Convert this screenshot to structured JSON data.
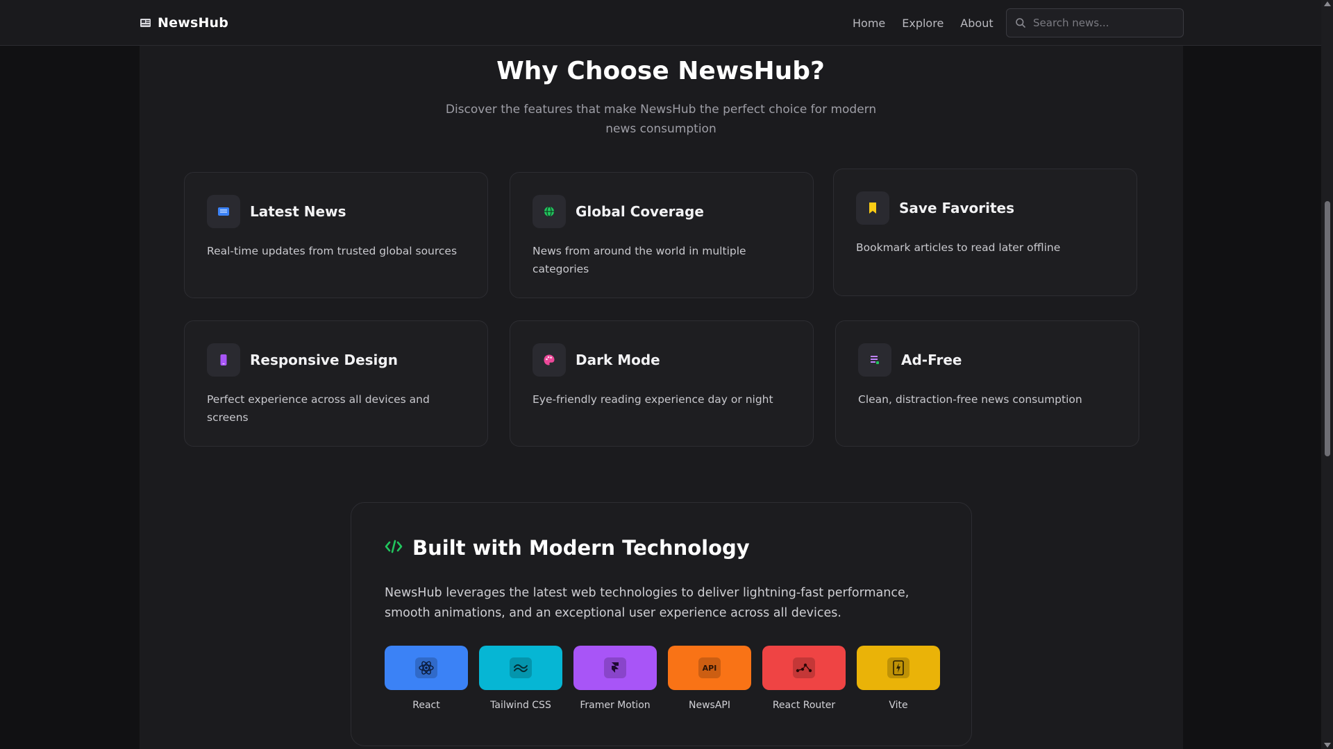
{
  "nav": {
    "brand": "NewsHub",
    "links": [
      "Home",
      "Explore",
      "About"
    ],
    "search_placeholder": "Search news..."
  },
  "hero": {
    "title": "Why Choose NewsHub?",
    "subtitle": "Discover the features that make NewsHub the perfect choice for modern news consumption"
  },
  "features": [
    {
      "title": "Latest News",
      "desc": "Real-time updates from trusted global sources",
      "icon": "newspaper-icon",
      "color": "#3b82f6"
    },
    {
      "title": "Global Coverage",
      "desc": "News from around the world in multiple categories",
      "icon": "globe-icon",
      "color": "#22c55e"
    },
    {
      "title": "Save Favorites",
      "desc": "Bookmark articles to read later offline",
      "icon": "bookmark-icon",
      "color": "#facc15"
    },
    {
      "title": "Responsive Design",
      "desc": "Perfect experience across all devices and screens",
      "icon": "phone-icon",
      "color": "#a855f7"
    },
    {
      "title": "Dark Mode",
      "desc": "Eye-friendly reading experience day or night",
      "icon": "palette-icon",
      "color": "#ec4899"
    },
    {
      "title": "Ad-Free",
      "desc": "Clean, distraction-free news consumption",
      "icon": "document-icon",
      "color": "#c084fc"
    }
  ],
  "tech": {
    "title": "Built with Modern Technology",
    "desc": "NewsHub leverages the latest web technologies to deliver lightning-fast performance, smooth animations, and an exceptional user experience across all devices.",
    "accent": "#22c55e",
    "stack": [
      {
        "label": "React",
        "color": "#3b82f6",
        "icon": "react-icon"
      },
      {
        "label": "Tailwind CSS",
        "color": "#06b6d4",
        "icon": "wave-icon"
      },
      {
        "label": "Framer Motion",
        "color": "#a855f7",
        "icon": "framer-icon"
      },
      {
        "label": "NewsAPI",
        "color": "#f97316",
        "icon": "api-icon",
        "glyph": "API"
      },
      {
        "label": "React Router",
        "color": "#ef4444",
        "icon": "router-icon"
      },
      {
        "label": "Vite",
        "color": "#eab308",
        "icon": "vite-icon"
      }
    ]
  }
}
